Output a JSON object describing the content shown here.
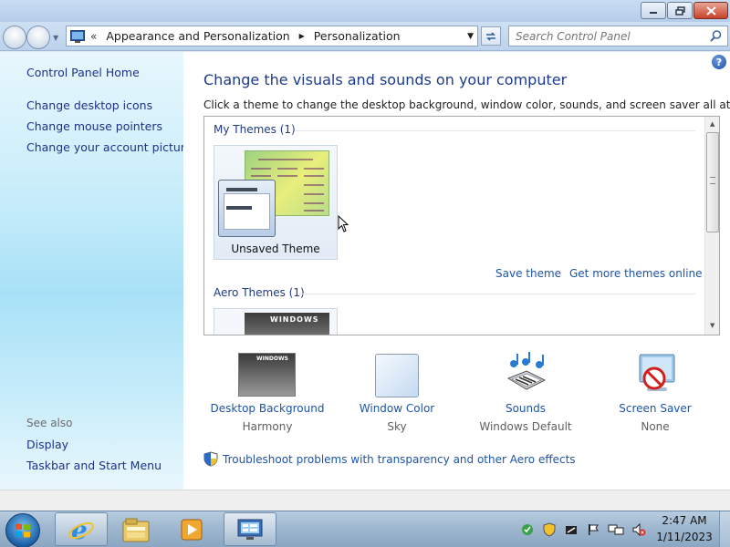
{
  "titlebar": {
    "minimize_icon": "minimize-icon",
    "maximize_icon": "maximize-icon",
    "close_icon": "close-icon"
  },
  "navbar": {
    "overflow_chevron": "«",
    "crumbs": [
      "Appearance and Personalization",
      "Personalization"
    ],
    "search_placeholder": "Search Control Panel"
  },
  "left_pane": {
    "home": "Control Panel Home",
    "links": [
      "Change desktop icons",
      "Change mouse pointers",
      "Change your account picture"
    ],
    "see_also_heading": "See also",
    "see_also": [
      "Display",
      "Taskbar and Start Menu"
    ]
  },
  "main": {
    "title": "Change the visuals and sounds on your computer",
    "subtitle": "Click a theme to change the desktop background, window color, sounds, and screen saver all at once.",
    "help": "?",
    "my_themes_label": "My Themes (1)",
    "unsaved_theme": "Unsaved Theme",
    "save_theme": "Save theme",
    "get_more": "Get more themes online",
    "aero_themes_label": "Aero Themes (1)",
    "thumb_banner": "WINDOWS",
    "options": [
      {
        "label": "Desktop Background",
        "value": "Harmony",
        "icon": "desktop-background-icon"
      },
      {
        "label": "Window Color",
        "value": "Sky",
        "icon": "window-color-icon"
      },
      {
        "label": "Sounds",
        "value": "Windows Default",
        "icon": "sounds-icon"
      },
      {
        "label": "Screen Saver",
        "value": "None",
        "icon": "screen-saver-icon"
      }
    ],
    "troubleshoot": "Troubleshoot problems with transparency and other Aero effects"
  },
  "taskbar": {
    "apps": [
      "internet-explorer-icon",
      "windows-explorer-icon",
      "media-player-icon",
      "control-panel-icon"
    ],
    "time": "2:47 AM",
    "date": "1/11/2023"
  },
  "colors": {
    "link": "#1e54a6",
    "title": "#1e3a8a",
    "left_pane": "#a8e1f7",
    "taskbar": "#9fb8d0"
  }
}
